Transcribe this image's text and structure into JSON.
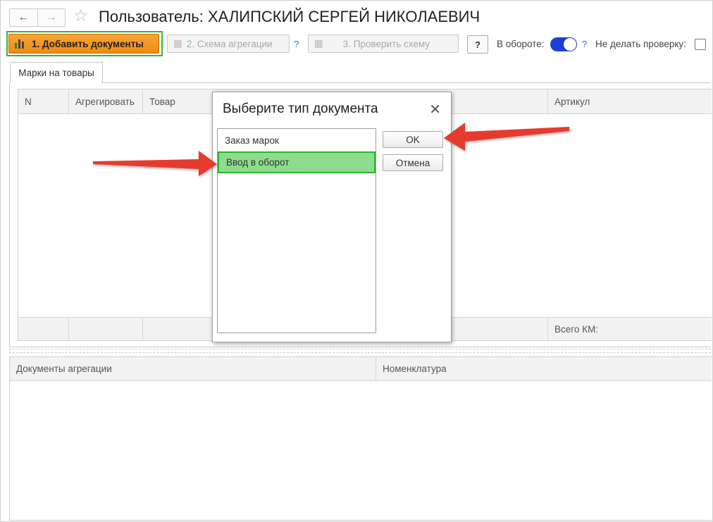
{
  "header": {
    "back_icon": "arrow-left-icon",
    "forward_icon": "arrow-right-icon",
    "favorite_icon": "star-icon",
    "title": "Пользователь: ХАЛИПСКИЙ СЕРГЕЙ НИКОЛАЕВИЧ"
  },
  "toolbar": {
    "add_documents": "1. Добавить документы",
    "aggregation_scheme": "2. Схема агрегации",
    "check_scheme": "3. Проверить схему",
    "help_mark": "?",
    "help_button": "?",
    "in_circulation_label": "В обороте:",
    "in_circulation_on": true,
    "no_check_label": "Не делать проверку:",
    "no_check_checked": false,
    "accent_color": "#f08a10"
  },
  "tabs": [
    {
      "label": "Марки на товары",
      "active": true
    }
  ],
  "grid": {
    "columns": [
      "N",
      "Агрегировать",
      "Товар",
      "Артикул"
    ],
    "footer_total": "Всего КМ:"
  },
  "lower_grid": {
    "columns": [
      "Документы  агрегации",
      "Номенклатура"
    ]
  },
  "dialog": {
    "title": "Выберите тип документа",
    "close_icon": "close-icon",
    "items": [
      {
        "label": "Заказ марок",
        "selected": false
      },
      {
        "label": "Ввод в оборот",
        "selected": true
      }
    ],
    "ok": "OK",
    "cancel": "Отмена",
    "selection_color": "#8edc8e"
  },
  "annotations": {
    "arrow_color": "#e53b2f"
  }
}
